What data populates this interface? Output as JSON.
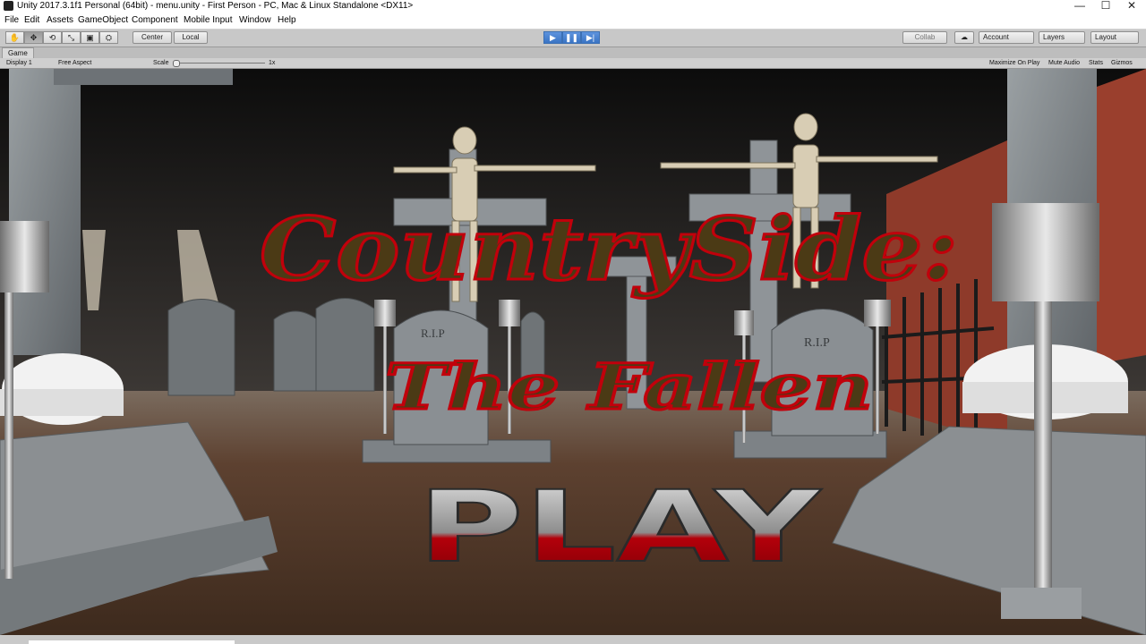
{
  "window": {
    "title": "Unity 2017.3.1f1 Personal (64bit) - menu.unity - First Person - PC, Mac & Linux Standalone <DX11>",
    "controls": {
      "minimize": "—",
      "maximize": "☐",
      "close": "✕"
    }
  },
  "menubar": {
    "items": [
      "File",
      "Edit",
      "Assets",
      "GameObject",
      "Component",
      "Mobile Input",
      "Window",
      "Help"
    ]
  },
  "toolbar": {
    "tools": [
      "✋",
      "✥",
      "⟲",
      "⤡",
      "▣",
      "⛭"
    ],
    "pivot": "Center",
    "space": "Local",
    "play": "▶",
    "pause": "❚❚",
    "step": "▶|",
    "collab": "Collab",
    "cloud": "☁",
    "account": "Account",
    "layers": "Layers",
    "layout": "Layout"
  },
  "game_view": {
    "tab": "Game",
    "display": "Display 1",
    "aspect": "Free Aspect",
    "scale_label": "Scale",
    "scale_value": "1x",
    "options": [
      "Maximize On Play",
      "Mute Audio",
      "Stats",
      "Gizmos"
    ]
  },
  "scene": {
    "title_line1": "CountrySide:",
    "title_line2": "The Fallen",
    "play_label": "PLAY",
    "tombstone_label": "R.I.P",
    "colors": {
      "blood": "#b8000a",
      "stone": "#8a8f93",
      "ground": "#5a3e2b",
      "brick": "#8e3a2a"
    }
  }
}
